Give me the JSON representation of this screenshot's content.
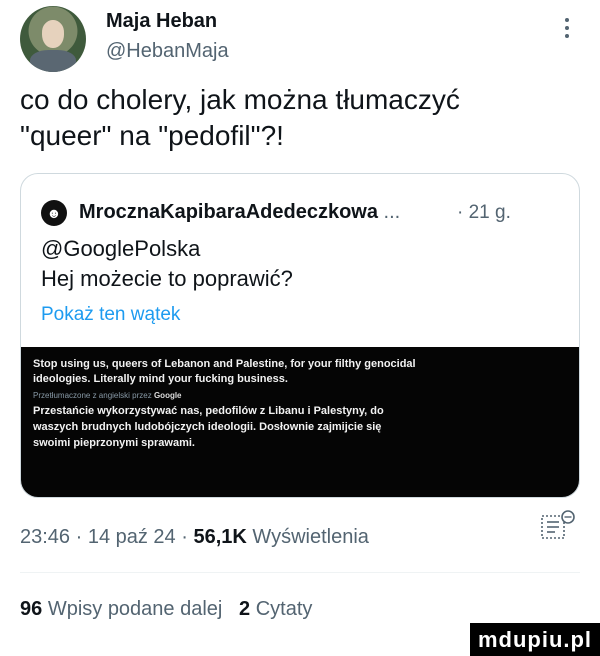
{
  "author": {
    "name": "Maja Heban",
    "handle": "@HebanMaja"
  },
  "tweet": {
    "text_line1": "co do cholery, jak można tłumaczyć",
    "text_line2": "\"queer\" na \"pedofil\"?!"
  },
  "quoted": {
    "name": "MrocznaKapibaraAdedeczkowa",
    "ellipsis": "...",
    "time": "· 21 g.",
    "body_line1": "@GooglePolska",
    "body_line2": "Hej możecie to poprawić?",
    "show_thread": "Pokaż ten wątek",
    "image": {
      "line1": "Stop using us, queers of Lebanon and Palestine, for your filthy genocidal",
      "line2": "ideologies. Literally mind your fucking business.",
      "translated_by": "Przetłumaczone z angielski przez",
      "translator": "Google",
      "line3": "Przestańcie wykorzystywać nas, pedofilów z Libanu i Palestyny, do",
      "line4": "waszych brudnych ludobójczych ideologii. Dosłownie zajmijcie się",
      "line5": "swoimi pieprzonymi sprawami."
    }
  },
  "meta": {
    "time": "23:46 · 14 paź 24 ·",
    "views_count": "56,1K",
    "views_label": "Wyświetlenia"
  },
  "stats": {
    "reposts_count": "96",
    "reposts_label": "Wpisy podane dalej",
    "quotes_count": "2",
    "quotes_label": "Cytaty"
  },
  "watermark": "mdupiu.pl"
}
